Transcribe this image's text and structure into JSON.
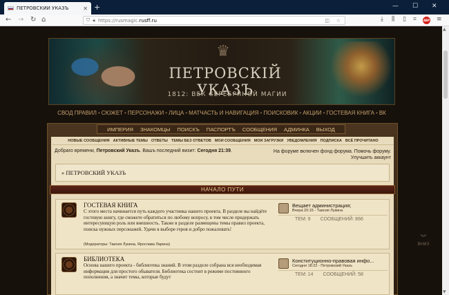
{
  "browser": {
    "tab_title": "ПЕТРОВСКИЙ УКАЗЪ",
    "url_protocol": "https://",
    "url_sub": "rusmagic.",
    "url_host": "rusff.ru",
    "addon_badge": "ABP"
  },
  "banner": {
    "title": "ПЕТРОВСКIЙ УКАЗЪ",
    "subtitle": "1812: ВЕК СЕРЕБРЯНОЙ МАГИИ"
  },
  "topnav": [
    "СВОД ПРАВИЛ",
    "СЮЖЕТ",
    "ПЕРСОНАЖИ",
    "ЛИЦА",
    "МАТЧАСТЬ И НАВИГАЦИЯ",
    "ПОИСКОВИК",
    "АКЦИИ",
    "ГОСТЕВАЯ КНИГА",
    "ВК"
  ],
  "subnav": [
    "ИМПЕРИЯ",
    "ЗНАКОМЦЫ",
    "ПОИСКЪ",
    "ПАСПОРТЪ",
    "СООБЩЕНИЯ",
    "АДМИНКА",
    "ВЫХОД"
  ],
  "userlinks": [
    "НОВЫЕ СООБЩЕНИЯ",
    "АКТИВНЫЕ ТЕМЫ",
    "ОТВЕТЫ",
    "ТЕМЫ БЕЗ ОТВЕТОВ",
    "МОИ СООБЩЕНИЯ",
    "МОИ ЗАГРУЗКИ",
    "УВЕДОМЛЕНИЯ",
    "ПОДПИСКА",
    "ВСЁ ПРОЧИТАНО"
  ],
  "welcome": {
    "prefix": "Добраго времени, ",
    "user": "Петровский Указъ",
    "middle": ". Вашъ последний визит: ",
    "visit": "Сегодня 21:39",
    "suffix": "."
  },
  "notice": {
    "line1": "На форуме включен фонд форума. Помочь форуму.",
    "line2": "Улучшить аккаунт"
  },
  "breadcrumb": "» ПЕТРОВСКИЙ УКАЗЪ",
  "section_title": "НАЧАЛО ПУТИ",
  "forums": [
    {
      "name": "ГОСТЕВАЯ КНИГА",
      "desc": "С этого места начинается путь каждого участника нашего проекта. В разделе вы найдёте гостевую книгу, где сможете обратиться по любому вопросу, в том числе придержать интересующую роль или внешность. Также в разделе размещены темы правил проекта, поиска нужных персонажей. Удачи в выборе героя и добро пожаловать!",
      "mods": "(Модераторы: Таисия Лукина, Ярослава Ларина)",
      "last_title": "Вещает администрация;",
      "last_meta": "Вчера 20:15 - Таисия Лукина",
      "topics": "ТЕМ: 9",
      "posts": "СООБЩЕНИЙ: 866"
    },
    {
      "name": "БИБЛИОТЕКА",
      "desc": "Основа нашего проекта - библиотека знаний. В этом разделе собрана вся необходимая информация для простого обывателя. Библиотека состоит в режиме постоянного пополнения, а значит темы, которые будут",
      "last_title": "Конституционно-правовая инфо...",
      "last_meta": "Сегодня 18:22 - Петровский Указъ",
      "topics": "ТЕМ: 14",
      "posts": "СООБЩЕНИЙ: 58"
    }
  ],
  "scroll_bottom_label": "ВНИЗ"
}
